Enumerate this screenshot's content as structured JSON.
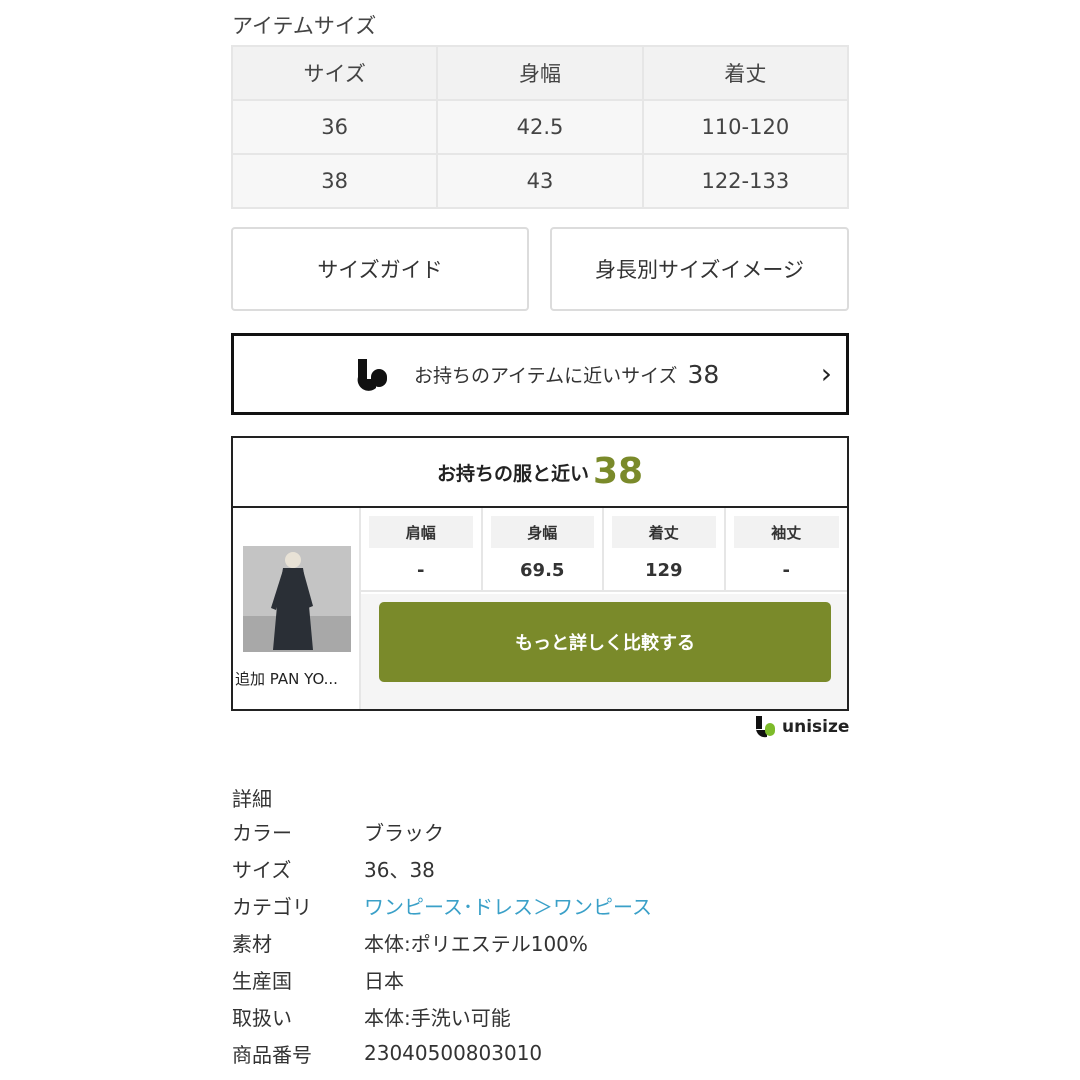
{
  "item_size": {
    "title": "アイテムサイズ",
    "headers": [
      "サイズ",
      "身幅",
      "着丈"
    ],
    "rows": [
      [
        "36",
        "42.5",
        "110-120"
      ],
      [
        "38",
        "43",
        "122-133"
      ]
    ]
  },
  "buttons": {
    "size_guide": "サイズガイド",
    "height_image": "身長別サイズイメージ"
  },
  "unisize_banner": {
    "label": "お持ちのアイテムに近いサイズ",
    "size": "38",
    "chevron": "›"
  },
  "compare": {
    "heading_text": "お持ちの服と近い",
    "heading_size": "38",
    "thumbnail_caption": "追加 PAN YO...",
    "measurements": [
      {
        "label": "肩幅",
        "value": "-"
      },
      {
        "label": "身幅",
        "value": "69.5"
      },
      {
        "label": "着丈",
        "value": "129"
      },
      {
        "label": "袖丈",
        "value": "-"
      }
    ],
    "compare_button": "もっと詳しく比較する",
    "accent_color": "#7a8a2a"
  },
  "brand": {
    "name": "unisize"
  },
  "details": {
    "title": "詳細",
    "color_label": "カラー",
    "color_value": "ブラック",
    "size_label": "サイズ",
    "size_value": "36、38",
    "category_label": "カテゴリ",
    "category_value_1": "ワンピース･ドレス",
    "category_sep": " ＞ ",
    "category_value_2": "ワンピース",
    "material_label": "素材",
    "material_value": "本体:ポリエステル100%",
    "origin_label": "生産国",
    "origin_value": "日本",
    "care_label": "取扱い",
    "care_value": "本体:手洗い可能",
    "product_no_label": "商品番号",
    "product_no_value": "23040500803010",
    "link_color": "#3aa0c8"
  }
}
